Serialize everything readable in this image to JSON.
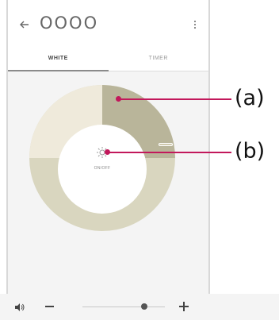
{
  "header": {
    "title": "OOOO",
    "back_icon": "arrow-left-icon",
    "menu_icon": "vertical-dots-icon"
  },
  "tabs": [
    {
      "label": "WHITE",
      "active": true
    },
    {
      "label": "TIMER",
      "active": false
    }
  ],
  "dial": {
    "onoff_label": "ON/OFF",
    "icon": "sun-icon",
    "colors": {
      "ring": "#d9d6bf",
      "segment_active": "#b9b59a",
      "segment_light": "#efeadb",
      "center": "#ffffff"
    }
  },
  "volume": {
    "level": 0.75,
    "speaker_icon": "speaker-icon",
    "minus_icon": "minus-icon",
    "plus_icon": "plus-icon"
  },
  "callouts": [
    {
      "label": "(a)"
    },
    {
      "label": "(b)"
    }
  ],
  "colors": {
    "callout": "#c2185b",
    "background": "#f4f4f4"
  }
}
